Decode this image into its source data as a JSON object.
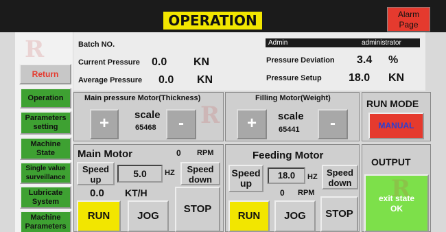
{
  "header": {
    "title": "OPERATION",
    "alarm_label_1": "Alarm",
    "alarm_label_2": "Page"
  },
  "nav": {
    "return_label": "Return",
    "items": [
      {
        "l1": "Operation",
        "l2": ""
      },
      {
        "l1": "Parameters",
        "l2": "setting"
      },
      {
        "l1": "Machine",
        "l2": "State"
      },
      {
        "l1": "Single value",
        "l2": "surveillance"
      },
      {
        "l1": "Lubricate",
        "l2": "System"
      },
      {
        "l1": "Machine",
        "l2": "Parameters"
      }
    ]
  },
  "info": {
    "batch_label": "Batch NO.",
    "current_pressure_label": "Current Pressure",
    "current_pressure_value": "0.0",
    "current_pressure_unit": "KN",
    "average_pressure_label": "Average Pressure",
    "average_pressure_value": "0.0",
    "average_pressure_unit": "KN",
    "user_role": "Admin",
    "user_name": "administrator",
    "pressure_deviation_label": "Pressure Deviation",
    "pressure_deviation_value": "3.4",
    "pressure_deviation_unit": "%",
    "pressure_setup_label": "Pressure Setup",
    "pressure_setup_value": "18.0",
    "pressure_setup_unit": "KN"
  },
  "main_pressure_motor": {
    "title": "Main pressure Motor(Thickness)",
    "plus": "+",
    "minus": "-",
    "scale_label": "scale",
    "scale_value": "65468"
  },
  "filling_motor": {
    "title": "Filling Motor(Weight)",
    "plus": "+",
    "minus": "-",
    "scale_label": "scale",
    "scale_value": "65441"
  },
  "run_mode": {
    "title": "RUN MODE",
    "mode_label": "MANUAL"
  },
  "main_motor": {
    "title": "Main Motor",
    "rpm_value": "0",
    "rpm_unit": "RPM",
    "speed_up_1": "Speed",
    "speed_up_2": "up",
    "speed_value": "5.0",
    "speed_unit": "HZ",
    "speed_down_1": "Speed",
    "speed_down_2": "down",
    "rate_value": "0.0",
    "rate_unit": "KT/H",
    "run_label": "RUN",
    "jog_label": "JOG",
    "stop_label": "STOP"
  },
  "feeding_motor": {
    "title": "Feeding Motor",
    "speed_up_1": "Speed",
    "speed_up_2": "up",
    "speed_value": "18.0",
    "speed_unit": "HZ",
    "speed_down_1": "Speed",
    "speed_down_2": "down",
    "rpm_value": "0",
    "rpm_unit": "RPM",
    "run_label": "RUN",
    "jog_label": "JOG",
    "stop_label": "STOP"
  },
  "output": {
    "title": "OUTPUT",
    "state_1": "exit state",
    "state_2": "OK"
  },
  "colors": {
    "accent_yellow": "#f2e600",
    "alarm_red": "#e53a2e",
    "nav_green": "#3ea132",
    "output_green": "#7de04a",
    "manual_text_blue": "#2b3fd1"
  },
  "icons": [
    "plus-icon",
    "minus-icon"
  ]
}
